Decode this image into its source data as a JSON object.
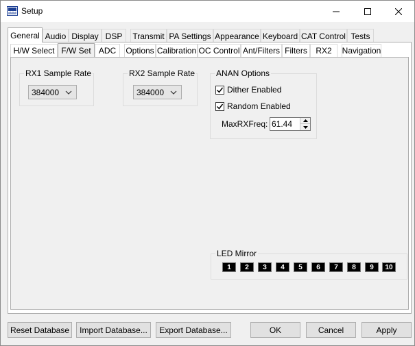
{
  "window": {
    "title": "Setup"
  },
  "tabs_main": [
    "General",
    "Audio",
    "Display",
    "DSP",
    "Transmit",
    "PA Settings",
    "Appearance",
    "Keyboard",
    "CAT Control",
    "Tests"
  ],
  "tabs_sub": [
    "H/W Select",
    "F/W Set",
    "ADC",
    "Options",
    "Calibration",
    "OC Control",
    "Ant/Filters",
    "Filters",
    "RX2",
    "Navigation"
  ],
  "rx1": {
    "title": "RX1 Sample Rate",
    "value": "384000"
  },
  "rx2": {
    "title": "RX2 Sample Rate",
    "value": "384000"
  },
  "anan": {
    "title": "ANAN Options",
    "dither_label": "Dither Enabled",
    "random_label": "Random Enabled",
    "maxrx_label": "MaxRXFreq:",
    "maxrx_value": "61.44"
  },
  "led_mirror": {
    "title": "LED Mirror",
    "buttons": [
      "1",
      "2",
      "3",
      "4",
      "5",
      "6",
      "7",
      "8",
      "9",
      "10"
    ]
  },
  "buttons": {
    "reset": "Reset Database",
    "import": "Import Database...",
    "export": "Export Database...",
    "ok": "OK",
    "cancel": "Cancel",
    "apply": "Apply"
  }
}
